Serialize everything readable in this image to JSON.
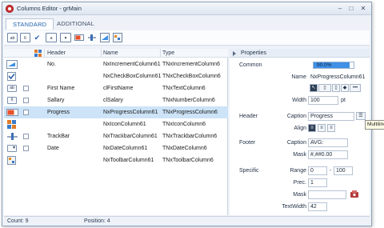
{
  "window": {
    "title": "Columns Editor - grMain"
  },
  "tabs": [
    {
      "label": "STANDARD"
    },
    {
      "label": "ADDITIONAL"
    }
  ],
  "toolbar": {
    "buttons": [
      {
        "icon": "text-column-icon",
        "label": "ab"
      },
      {
        "icon": "number-column-icon",
        "label": "6"
      },
      {
        "icon": "checkbox-column-icon",
        "label": "✔"
      },
      {
        "icon": "combo-column-icon",
        "label": "a"
      },
      {
        "icon": "date-column-icon",
        "label": "▾"
      },
      {
        "icon": "progress-column-icon",
        "label": ""
      },
      {
        "icon": "trackbar-column-icon",
        "label": ""
      },
      {
        "icon": "increment-column-icon",
        "label": ""
      },
      {
        "icon": "toolbar-column-icon",
        "label": ""
      }
    ]
  },
  "grid": {
    "headers": {
      "header": "Header",
      "name": "Name",
      "type": "Type"
    },
    "rows": [
      {
        "icon": "increment-icon",
        "checkbox": false,
        "header": "No.",
        "name": "NxIncrementColumn61",
        "type": "TNxIncrementColumn6"
      },
      {
        "icon": "checkbox-icon",
        "checkbox": false,
        "header": "",
        "name": "NxCheckBoxColumn61",
        "type": "TNxCheckBoxColumn6"
      },
      {
        "icon": "text-icon",
        "checkbox": true,
        "header": "First Name",
        "name": "clFirstName",
        "type": "TNxTextColumn6"
      },
      {
        "icon": "number-icon",
        "checkbox": true,
        "header": "Sallary",
        "name": "clSalary",
        "type": "TNxNumberColumn6"
      },
      {
        "icon": "progress-icon",
        "checkbox": true,
        "header": "Progress",
        "name": "NxProgressColumn61",
        "type": "TNxProgressColumn6"
      },
      {
        "icon": "image-icon",
        "checkbox": false,
        "header": "",
        "name": "NxIconColumn61",
        "type": "TNxIconColumn6"
      },
      {
        "icon": "trackbar-icon",
        "checkbox": true,
        "header": "TrackBar",
        "name": "NxTrackbarColumn61",
        "type": "TNxTrackbarColumn6"
      },
      {
        "icon": "date-icon",
        "checkbox": true,
        "header": "Date",
        "name": "NxDateColumn61",
        "type": "TNxDateColumn6"
      },
      {
        "icon": "toolbar-icon",
        "checkbox": false,
        "header": "",
        "name": "NxToolbarColumn61",
        "type": "TNxToolbarColumn6"
      }
    ]
  },
  "properties": {
    "title": "Properties",
    "common_label": "Common",
    "progress": {
      "text": "90.0%",
      "value": 0.9
    },
    "name_label": "Name",
    "name_value": "NxProgressColumn61",
    "width_label": "Width",
    "width_value": "100",
    "width_unit": "pt",
    "header_label": "Header",
    "caption_label": "Caption",
    "caption_value": "Progress",
    "align_label": "Align",
    "footer_label": "Footer",
    "footer_caption_label": "Caption",
    "footer_caption_value": "AVG:",
    "mask_label": "Mask",
    "mask_value": "#,##0.00",
    "specific_label": "Specific",
    "range_label": "Range",
    "range_from": "0",
    "range_sep": "-",
    "range_to": "100",
    "prec_label": "Prec.",
    "prec_value": "1",
    "specific_mask_label": "Mask",
    "specific_mask_value": "",
    "textwidth_label": "TextWidth",
    "textwidth_value": "42"
  },
  "tooltip": {
    "text": "Multiline"
  },
  "status": {
    "count": "Count: 9",
    "position": "Position: 4"
  },
  "colors": {
    "accent": "#3f90e6",
    "selection": "#cde3f7"
  }
}
